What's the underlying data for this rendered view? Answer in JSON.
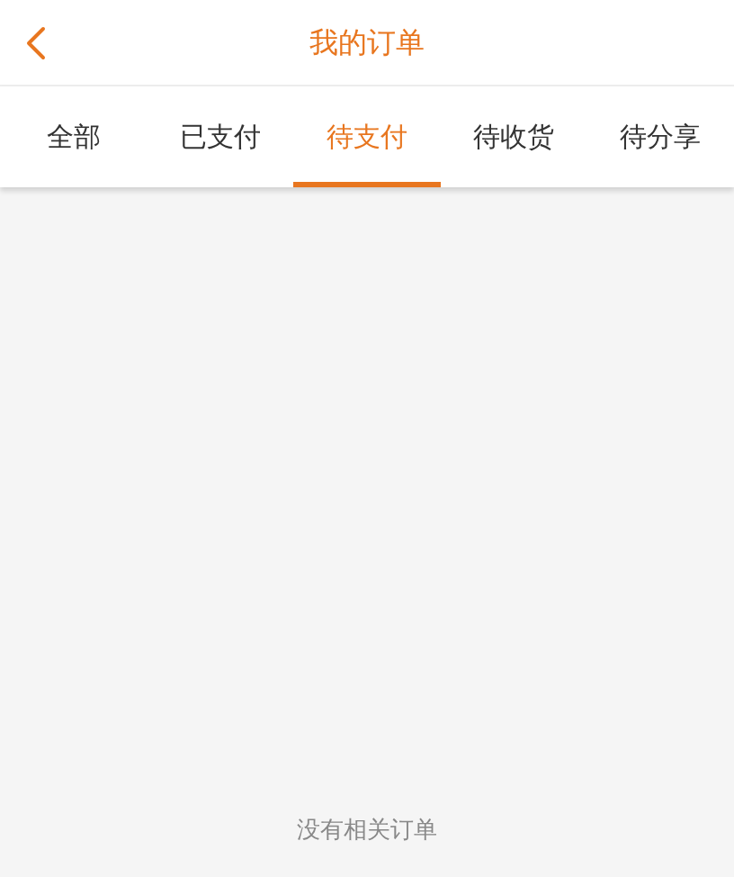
{
  "header": {
    "title": "我的订单"
  },
  "tabs": [
    {
      "label": "全部",
      "selected": false
    },
    {
      "label": "已支付",
      "selected": false
    },
    {
      "label": "待支付",
      "selected": true
    },
    {
      "label": "待收货",
      "selected": false
    },
    {
      "label": "待分享",
      "selected": false
    }
  ],
  "empty_message": "没有相关订单"
}
